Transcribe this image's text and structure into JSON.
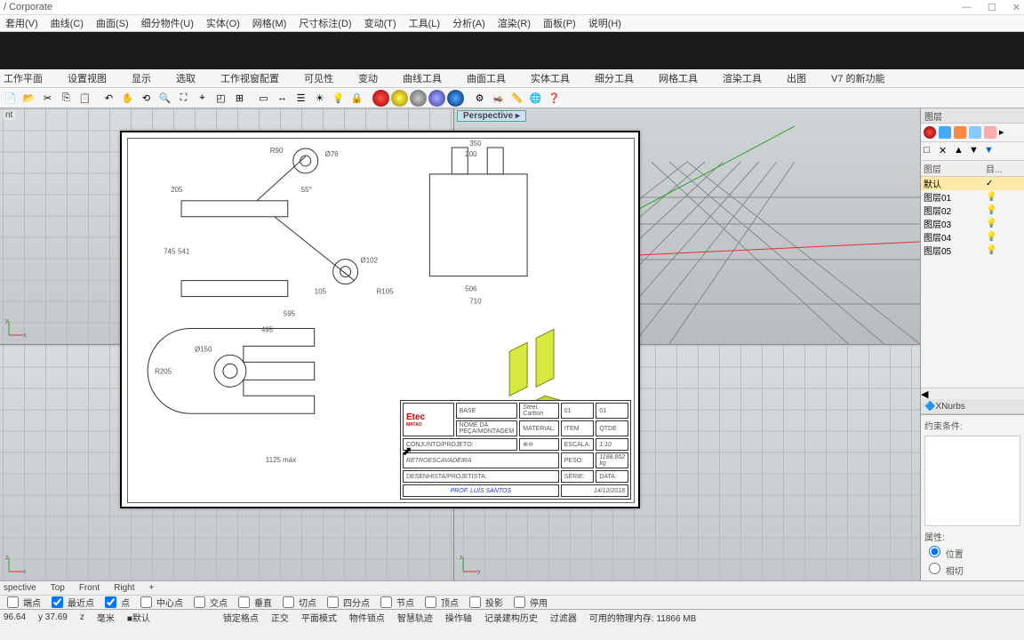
{
  "title": "/ Corporate",
  "menu": [
    "套用(V)",
    "曲线(C)",
    "曲面(S)",
    "细分物件(U)",
    "实体(O)",
    "网格(M)",
    "尺寸标注(D)",
    "变动(T)",
    "工具(L)",
    "分析(A)",
    "渲染(R)",
    "面板(P)",
    "说明(H)"
  ],
  "ribbon": [
    "工作平面",
    "设置视图",
    "显示",
    "选取",
    "工作视窗配置",
    "可见性",
    "变动",
    "曲线工具",
    "曲面工具",
    "实体工具",
    "细分工具",
    "网格工具",
    "渲染工具",
    "出图",
    "V7 的新功能"
  ],
  "views": {
    "tl": "nt",
    "tr": "Perspective",
    "bl": "",
    "br": ""
  },
  "sidepanel": {
    "hdr": "图层",
    "cols": [
      "图层",
      "目..."
    ],
    "rows": [
      {
        "name": "默认",
        "def": true,
        "chk": "✓"
      },
      {
        "name": "图层01"
      },
      {
        "name": "图层02"
      },
      {
        "name": "图层03"
      },
      {
        "name": "图层04"
      },
      {
        "name": "图层05"
      }
    ],
    "xnurbs": "XNurbs",
    "constraint": "约束条件:",
    "attrs": "属性:",
    "pos": "位置",
    "tan": "相切"
  },
  "tabs": [
    "spective",
    "Top",
    "Front",
    "Right",
    "+"
  ],
  "snap": {
    "items": [
      "端点",
      "最近点",
      "点",
      "中心点",
      "交点",
      "垂直",
      "切点",
      "四分点",
      "节点",
      "顶点",
      "投影",
      "停用"
    ],
    "checked": [
      false,
      true,
      true,
      false,
      false,
      false,
      false,
      false,
      false,
      false,
      false,
      false
    ]
  },
  "status": {
    "x": "96.64",
    "y": "y 37.69",
    "z": "z",
    "unit": "毫米",
    "layer": "默认",
    "items": [
      "锁定格点",
      "正交",
      "平面模式",
      "物件锁点",
      "智慧轨迹",
      "操作轴",
      "记录建构历史",
      "过滤器"
    ],
    "mem": "可用的物理内存: 11866 MB"
  },
  "titleblock": {
    "logo": "Etec",
    "sub": "MATAO",
    "r1a": "BASE",
    "r1b": "Steel, Carbon",
    "r1c": "01",
    "r1d": "01",
    "r2a": "NOME DA PEÇA/MONTAGEM",
    "r2b": "MATERIAL:",
    "r2c": "ITEM",
    "r2d": "QTDE",
    "r3a": "CONJUNTO/PROJETO:",
    "r3b": "ESCALA:",
    "r3c": "1:10",
    "r4a": "RETROESCAVADEIRA",
    "r4b": "PESO:",
    "r4c": "1188.862 kg",
    "r5a": "DESENHISTA/PROJETISTA:",
    "r5b": "SÉRIE:",
    "r5c": "DATA:",
    "r6a": "PROF. LUÍS SANTOS",
    "r6b": "14/12/2018"
  },
  "dims": {
    "r90": "R90",
    "d76": "Ø76",
    "d205": "205",
    "d745": "745",
    "d541": "541",
    "d55": "55°",
    "d102": "Ø102",
    "d105": "105",
    "r105": "R105",
    "d595": "595",
    "d350": "350",
    "d200": "200",
    "d506": "506",
    "d710": "710",
    "d495": "495",
    "d150": "Ø150",
    "r205": "R205",
    "d1125": "1125 máx"
  }
}
